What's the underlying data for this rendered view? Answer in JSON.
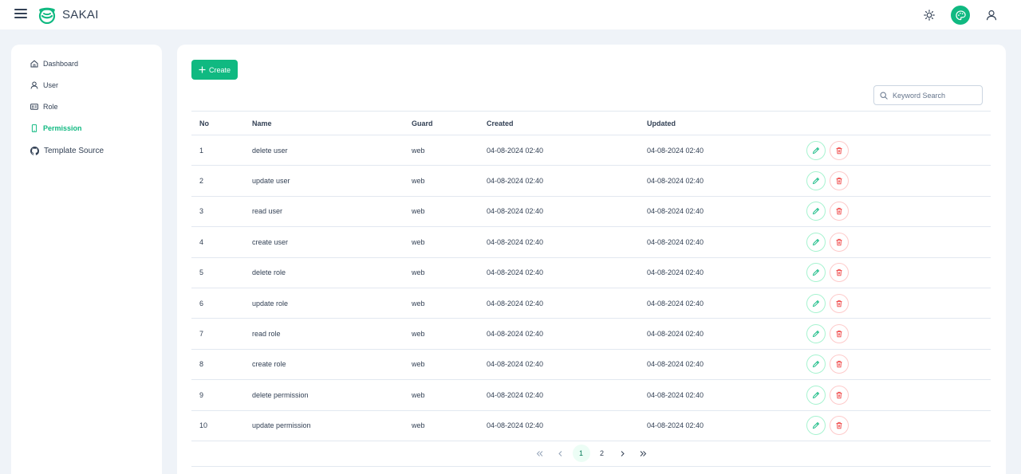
{
  "app": {
    "name": "SAKAI"
  },
  "colors": {
    "accent": "#10b981",
    "danger": "#ef4444",
    "text": "#334155"
  },
  "topbar": {
    "icons": [
      "menu-icon",
      "sun-icon",
      "palette-icon",
      "user-icon"
    ]
  },
  "sidebar": {
    "items": [
      {
        "label": "Dashboard",
        "icon": "home-icon"
      },
      {
        "label": "User",
        "icon": "user-icon"
      },
      {
        "label": "Role",
        "icon": "id-card-icon"
      },
      {
        "label": "Permission",
        "icon": "mobile-icon",
        "active": true
      },
      {
        "label": "Template Source",
        "icon": "github-icon"
      }
    ]
  },
  "toolbar": {
    "create_label": "Create"
  },
  "search": {
    "placeholder": "Keyword Search"
  },
  "table": {
    "headers": {
      "no": "No",
      "name": "Name",
      "guard": "Guard",
      "created": "Created",
      "updated": "Updated"
    },
    "rows": [
      {
        "no": "1",
        "name": "delete user",
        "guard": "web",
        "created": "04-08-2024 02:40",
        "updated": "04-08-2024 02:40"
      },
      {
        "no": "2",
        "name": "update user",
        "guard": "web",
        "created": "04-08-2024 02:40",
        "updated": "04-08-2024 02:40"
      },
      {
        "no": "3",
        "name": "read user",
        "guard": "web",
        "created": "04-08-2024 02:40",
        "updated": "04-08-2024 02:40"
      },
      {
        "no": "4",
        "name": "create user",
        "guard": "web",
        "created": "04-08-2024 02:40",
        "updated": "04-08-2024 02:40"
      },
      {
        "no": "5",
        "name": "delete role",
        "guard": "web",
        "created": "04-08-2024 02:40",
        "updated": "04-08-2024 02:40"
      },
      {
        "no": "6",
        "name": "update role",
        "guard": "web",
        "created": "04-08-2024 02:40",
        "updated": "04-08-2024 02:40"
      },
      {
        "no": "7",
        "name": "read role",
        "guard": "web",
        "created": "04-08-2024 02:40",
        "updated": "04-08-2024 02:40"
      },
      {
        "no": "8",
        "name": "create role",
        "guard": "web",
        "created": "04-08-2024 02:40",
        "updated": "04-08-2024 02:40"
      },
      {
        "no": "9",
        "name": "delete permission",
        "guard": "web",
        "created": "04-08-2024 02:40",
        "updated": "04-08-2024 02:40"
      },
      {
        "no": "10",
        "name": "update permission",
        "guard": "web",
        "created": "04-08-2024 02:40",
        "updated": "04-08-2024 02:40"
      }
    ]
  },
  "pagination": {
    "pages": [
      "1",
      "2"
    ],
    "current": "1"
  }
}
